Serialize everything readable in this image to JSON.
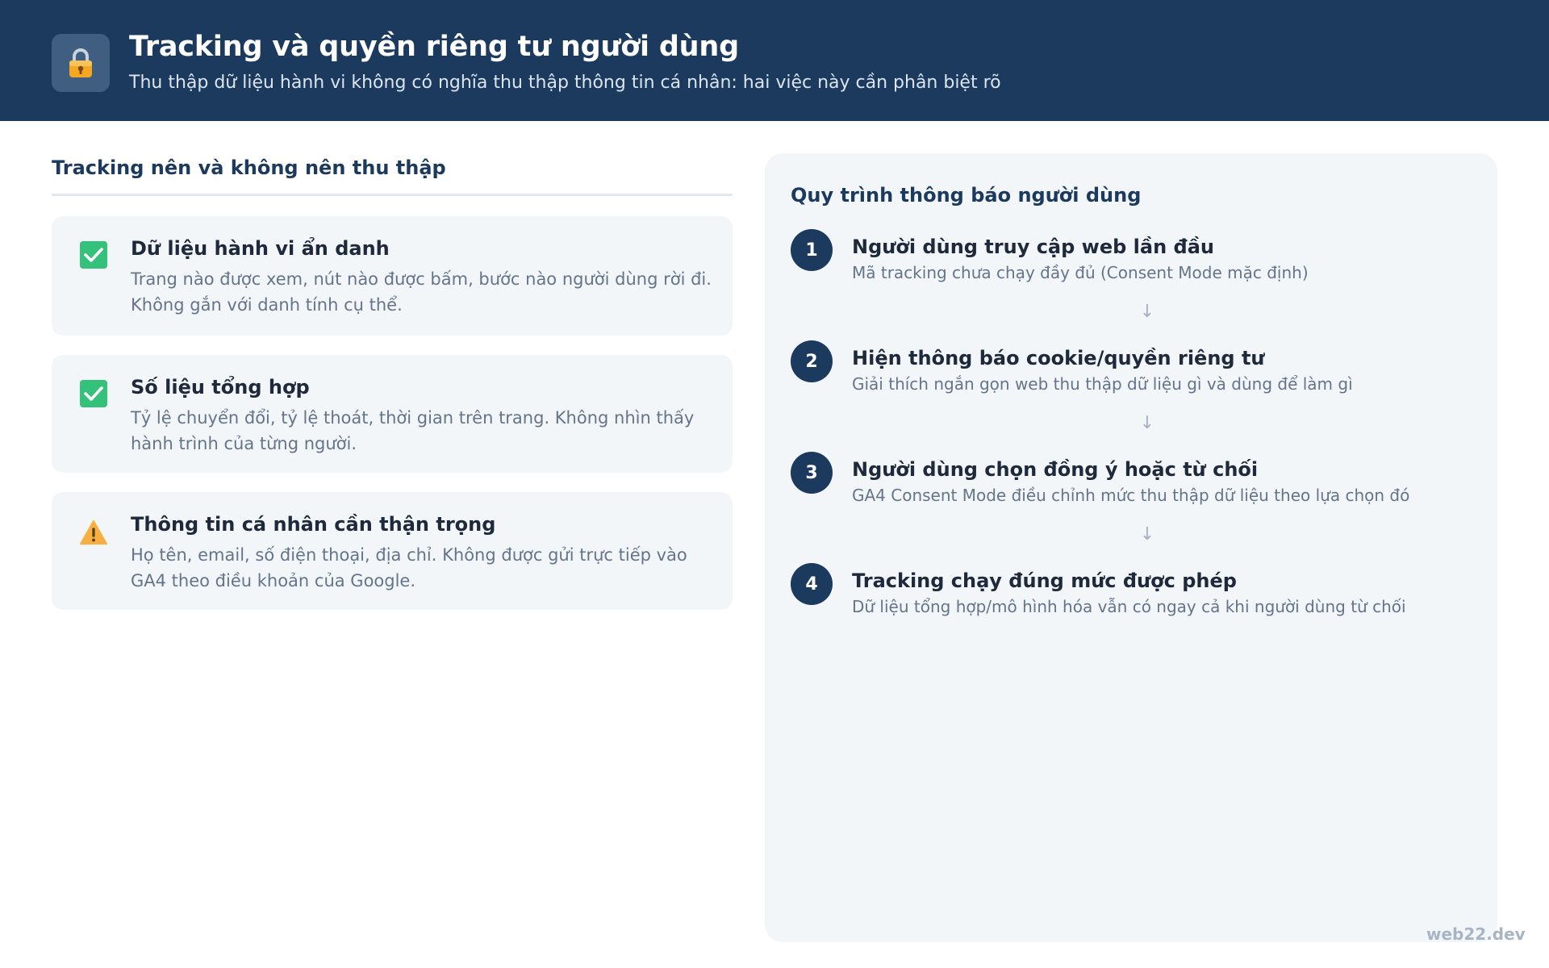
{
  "header": {
    "icon": "lock-icon",
    "title": "Tracking và quyền riêng tư người dùng",
    "subtitle": "Thu thập dữ liệu hành vi không có nghĩa thu thập thông tin cá nhân: hai việc này cần phân biệt rõ"
  },
  "left": {
    "title": "Tracking nên và không nên thu thập",
    "cards": [
      {
        "icon": "check-icon",
        "title": "Dữ liệu hành vi ẩn danh",
        "desc": "Trang nào được xem, nút nào được bấm, bước nào người dùng rời đi. Không gắn với danh tính cụ thể."
      },
      {
        "icon": "check-icon",
        "title": "Số liệu tổng hợp",
        "desc": "Tỷ lệ chuyển đổi, tỷ lệ thoát, thời gian trên trang. Không nhìn thấy hành trình của từng người."
      },
      {
        "icon": "warning-icon",
        "title": "Thông tin cá nhân cần thận trọng",
        "desc": "Họ tên, email, số điện thoại, địa chỉ. Không được gửi trực tiếp vào GA4 theo điều khoản của Google."
      }
    ]
  },
  "right": {
    "title": "Quy trình thông báo người dùng",
    "steps": [
      {
        "number": "1",
        "title": "Người dùng truy cập web lần đầu",
        "desc": "Mã tracking chưa chạy đầy đủ (Consent Mode mặc định)"
      },
      {
        "number": "2",
        "title": "Hiện thông báo cookie/quyền riêng tư",
        "desc": "Giải thích ngắn gọn web thu thập dữ liệu gì và dùng để làm gì"
      },
      {
        "number": "3",
        "title": "Người dùng chọn đồng ý hoặc từ chối",
        "desc": "GA4 Consent Mode điều chỉnh mức thu thập dữ liệu theo lựa chọn đó"
      },
      {
        "number": "4",
        "title": "Tracking chạy đúng mức được phép",
        "desc": "Dữ liệu tổng hợp/mô hình hóa vẫn có ngay cả khi người dùng từ chối"
      }
    ],
    "arrow": "↓"
  },
  "watermark": "web22.dev",
  "colors": {
    "header_bg": "#1b3a5e",
    "accent": "#1b3a5e",
    "check_green": "#34c27a",
    "warning_amber": "#f5b041",
    "card_bg": "#f3f6f9"
  }
}
